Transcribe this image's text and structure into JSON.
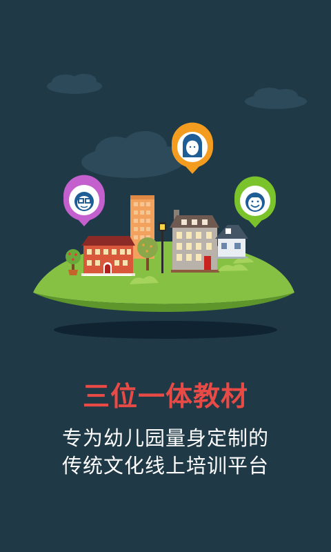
{
  "splash": {
    "headline": "三位一体教材",
    "subtitle_line1": "专为幼儿园量身定制的",
    "subtitle_line2": "传统文化线上培训平台"
  },
  "illustration": {
    "pins": [
      {
        "name": "pin-teacher-girl",
        "color": "#f39c1f",
        "icon": "girl-avatar-icon"
      },
      {
        "name": "pin-boy-glasses",
        "color": "#c45fce",
        "icon": "boy-glasses-avatar-icon"
      },
      {
        "name": "pin-child-smile",
        "color": "#7ac32b",
        "icon": "child-smile-avatar-icon"
      }
    ]
  },
  "colors": {
    "background": "#1f3947",
    "headline": "#e84a45",
    "subtitle": "#ffffff",
    "island_top": "#86c144",
    "island_shadow": "#0f2430"
  }
}
